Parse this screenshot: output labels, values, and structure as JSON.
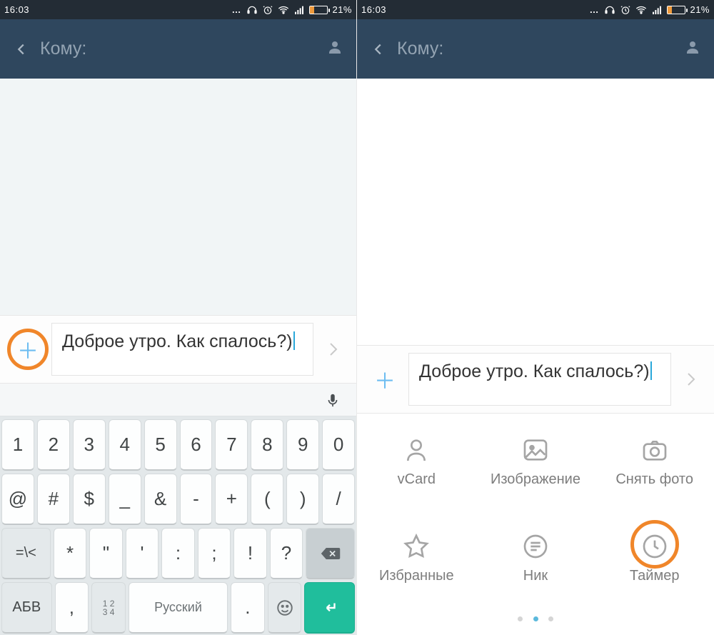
{
  "status_bar": {
    "time": "16:03",
    "battery_pct": "21%"
  },
  "header": {
    "recipient_label": "Кому:"
  },
  "compose": {
    "message_text": "Доброе утро. Как спалось?)"
  },
  "keyboard": {
    "row_numbers": [
      "1",
      "2",
      "3",
      "4",
      "5",
      "6",
      "7",
      "8",
      "9",
      "0"
    ],
    "row_symbols1": [
      "@",
      "#",
      "$",
      "_",
      "&",
      "-",
      "+",
      "(",
      ")",
      "/"
    ],
    "row_symbols2_toggle": "=\\<",
    "row_symbols2": [
      "*",
      "\"",
      "'",
      ":",
      ";",
      "!",
      "?"
    ],
    "abc_label": "АБВ",
    "comma": ",",
    "digits_small": "1 2\n3 4",
    "space_label": "Русский"
  },
  "attachments": {
    "items": [
      {
        "label": "vCard"
      },
      {
        "label": "Изображение"
      },
      {
        "label": "Снять фото"
      },
      {
        "label": "Избранные"
      },
      {
        "label": "Ник"
      },
      {
        "label": "Таймер"
      }
    ]
  }
}
